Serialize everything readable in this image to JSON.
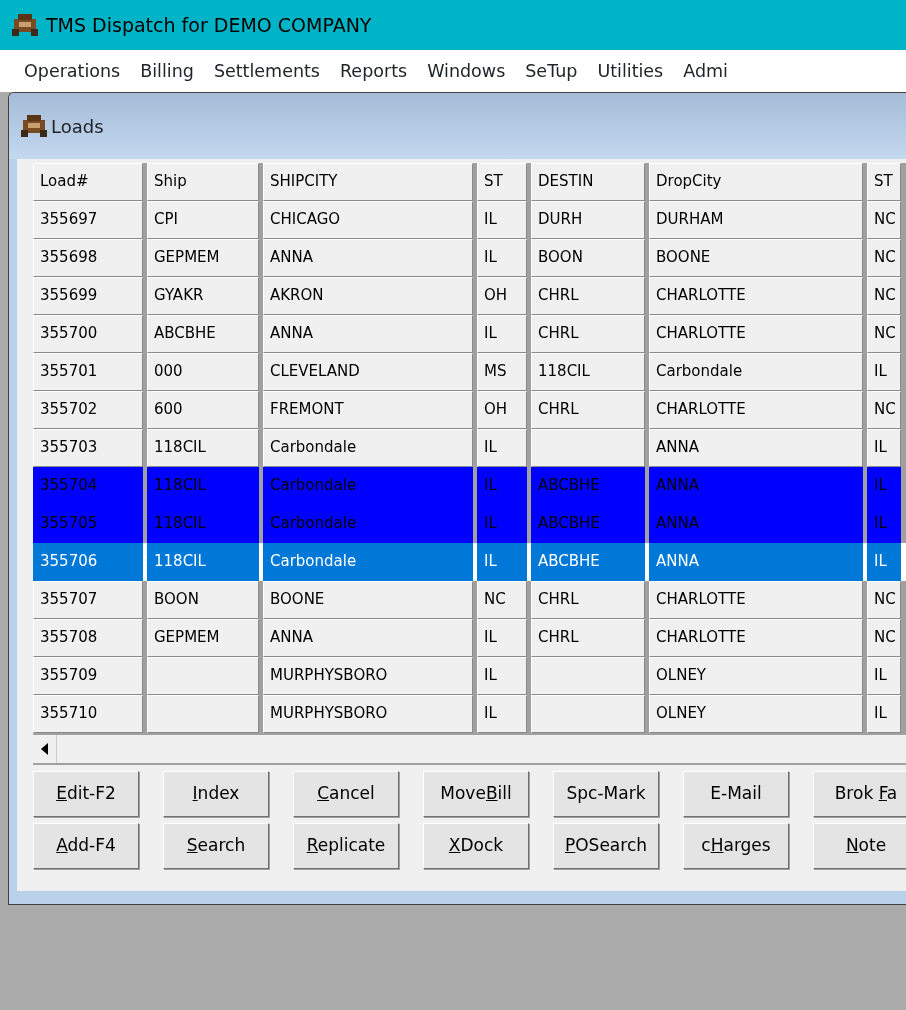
{
  "window": {
    "title": "TMS Dispatch for DEMO COMPANY"
  },
  "menu": [
    "Operations",
    "Billing",
    "Settlements",
    "Reports",
    "Windows",
    "SeTup",
    "Utilities",
    "Admi"
  ],
  "child_window": {
    "title": "Loads"
  },
  "table": {
    "columns": [
      "Load#",
      "Ship",
      "SHIPCITY",
      "ST",
      "DESTIN",
      "DropCity",
      "ST"
    ],
    "rows": [
      {
        "cells": [
          "355697",
          "CPI",
          "CHICAGO",
          "IL",
          "DURH",
          "DURHAM",
          "NC"
        ],
        "marked": false,
        "selected": false
      },
      {
        "cells": [
          "355698",
          "GEPMEM",
          "ANNA",
          "IL",
          "BOON",
          "BOONE",
          "NC"
        ],
        "marked": false,
        "selected": false
      },
      {
        "cells": [
          "355699",
          "GYAKR",
          "AKRON",
          "OH",
          "CHRL",
          "CHARLOTTE",
          "NC"
        ],
        "marked": false,
        "selected": false
      },
      {
        "cells": [
          "355700",
          "ABCBHE",
          "ANNA",
          "IL",
          "CHRL",
          "CHARLOTTE",
          "NC"
        ],
        "marked": false,
        "selected": false
      },
      {
        "cells": [
          "355701",
          "000",
          "CLEVELAND",
          "MS",
          "118CIL",
          "Carbondale",
          "IL"
        ],
        "marked": false,
        "selected": false
      },
      {
        "cells": [
          "355702",
          "600",
          "FREMONT",
          "OH",
          "CHRL",
          "CHARLOTTE",
          "NC"
        ],
        "marked": false,
        "selected": false
      },
      {
        "cells": [
          "355703",
          "118CIL",
          "Carbondale",
          "IL",
          "",
          "ANNA",
          "IL"
        ],
        "marked": false,
        "selected": false
      },
      {
        "cells": [
          "355704",
          "118CIL",
          "Carbondale",
          "IL",
          "ABCBHE",
          "ANNA",
          "IL"
        ],
        "marked": true,
        "selected": false
      },
      {
        "cells": [
          "355705",
          "118CIL",
          "Carbondale",
          "IL",
          "ABCBHE",
          "ANNA",
          "IL"
        ],
        "marked": true,
        "selected": false
      },
      {
        "cells": [
          "355706",
          "118CIL",
          "Carbondale",
          "IL",
          "ABCBHE",
          "ANNA",
          "IL"
        ],
        "marked": false,
        "selected": true
      },
      {
        "cells": [
          "355707",
          "BOON",
          "BOONE",
          "NC",
          "CHRL",
          "CHARLOTTE",
          "NC"
        ],
        "marked": false,
        "selected": false
      },
      {
        "cells": [
          "355708",
          "GEPMEM",
          "ANNA",
          "IL",
          "CHRL",
          "CHARLOTTE",
          "NC"
        ],
        "marked": false,
        "selected": false
      },
      {
        "cells": [
          "355709",
          "",
          "MURPHYSBORO",
          "IL",
          "",
          "OLNEY",
          "IL"
        ],
        "marked": false,
        "selected": false
      },
      {
        "cells": [
          "355710",
          "",
          "MURPHYSBORO",
          "IL",
          "",
          "OLNEY",
          "IL"
        ],
        "marked": false,
        "selected": false
      }
    ]
  },
  "buttons": [
    [
      {
        "key": "E",
        "after": "dit-F2"
      },
      {
        "key": "I",
        "after": "ndex"
      },
      {
        "key": "C",
        "after": "ancel"
      },
      {
        "before": "Move",
        "key": "B",
        "after": "ill"
      },
      {
        "before": "Spc-Mark"
      },
      {
        "before": "E-Mail"
      },
      {
        "before": "Brok ",
        "key": "F",
        "after": "a"
      }
    ],
    [
      {
        "key": "A",
        "after": "dd-F4"
      },
      {
        "key": "S",
        "after": "earch"
      },
      {
        "key": "R",
        "after": "eplicate"
      },
      {
        "key": "X",
        "after": "Dock"
      },
      {
        "key": "P",
        "after": "OSearch"
      },
      {
        "before": "c",
        "key": "H",
        "after": "arges"
      },
      {
        "key": "N",
        "after": "ote"
      }
    ]
  ]
}
